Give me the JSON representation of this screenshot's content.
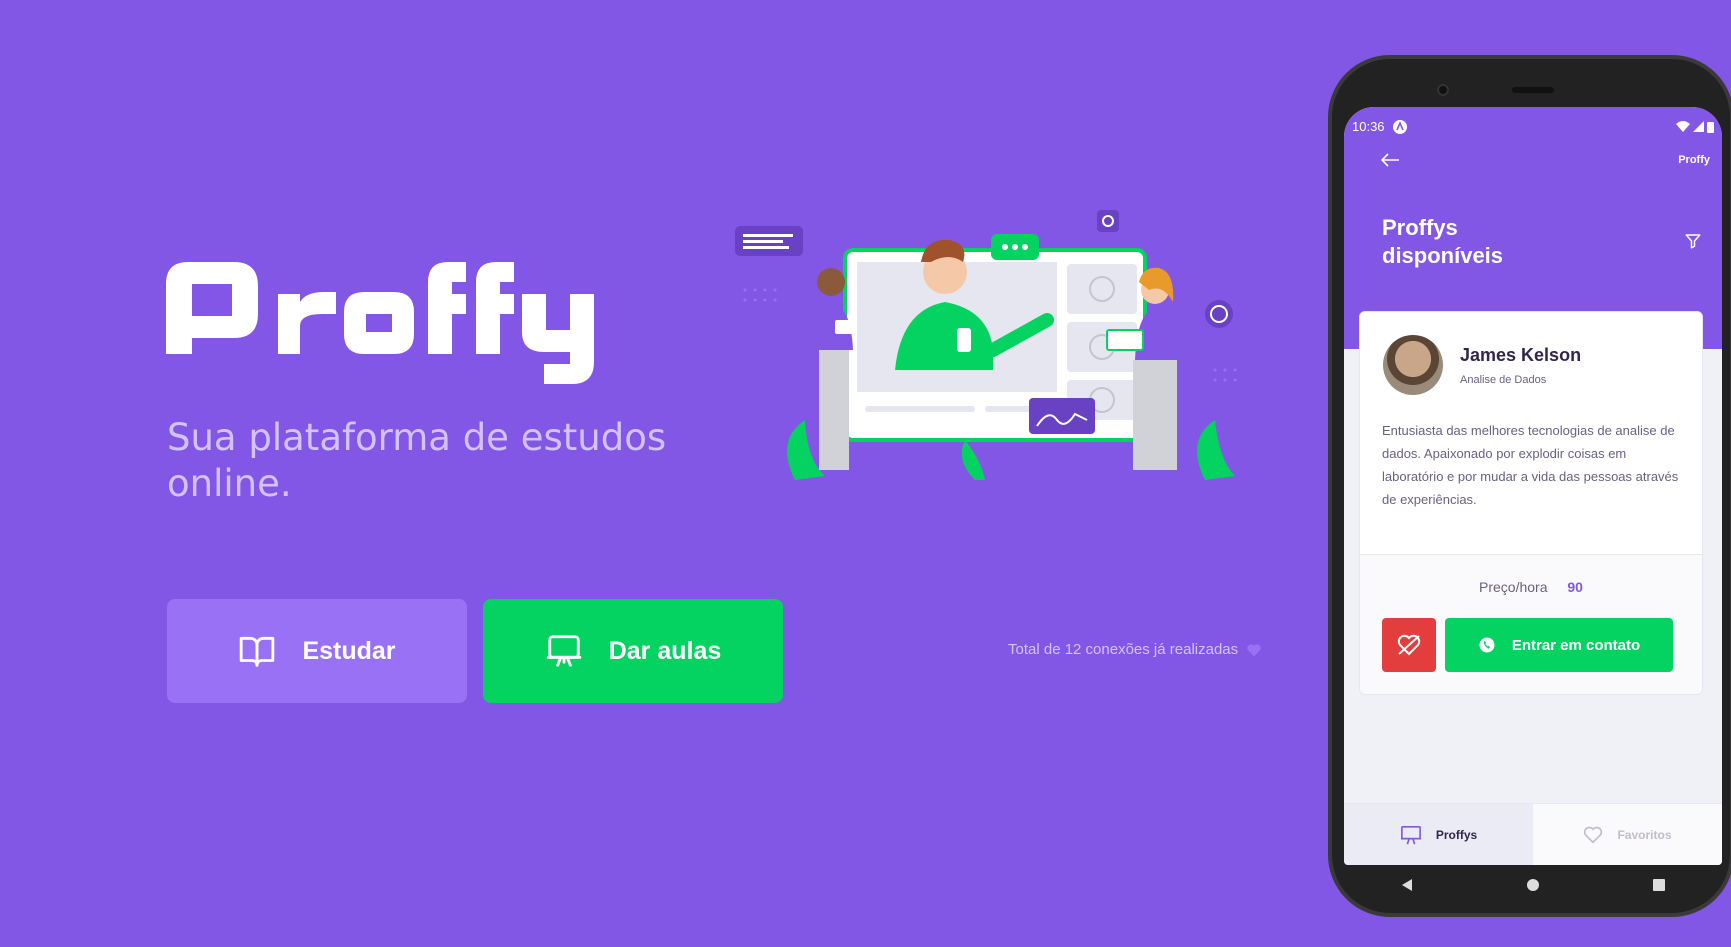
{
  "landing": {
    "logo_text": "Proffy",
    "tagline": "Sua plataforma de estudos online.",
    "buttons": {
      "study_label": "Estudar",
      "teach_label": "Dar aulas"
    },
    "connections_text": "Total de 12 conexões já realizadas",
    "colors": {
      "primary": "#8257E5",
      "primary_light": "#9871F5",
      "secondary": "#04D361",
      "text_light": "#D4C2FF"
    }
  },
  "phone": {
    "status": {
      "time": "10:36"
    },
    "topbar": {
      "brand": "Proffy",
      "back_icon": "arrow-left-icon"
    },
    "title": "Proffys disponíveis",
    "filter_icon": "filter-icon",
    "teacher": {
      "name": "James Kelson",
      "subject": "Analise de Dados",
      "bio": "Entusiasta das melhores tecnologias de analise de dados. Apaixonado por explodir coisas em laboratório e por mudar a vida das pessoas através de experiências.",
      "price_label": "Preço/hora",
      "price_value": "90",
      "contact_label": "Entrar em contato"
    },
    "tabs": [
      {
        "label": "Proffys",
        "icon": "screen-icon",
        "active": true
      },
      {
        "label": "Favoritos",
        "icon": "heart-icon",
        "active": false
      }
    ]
  }
}
